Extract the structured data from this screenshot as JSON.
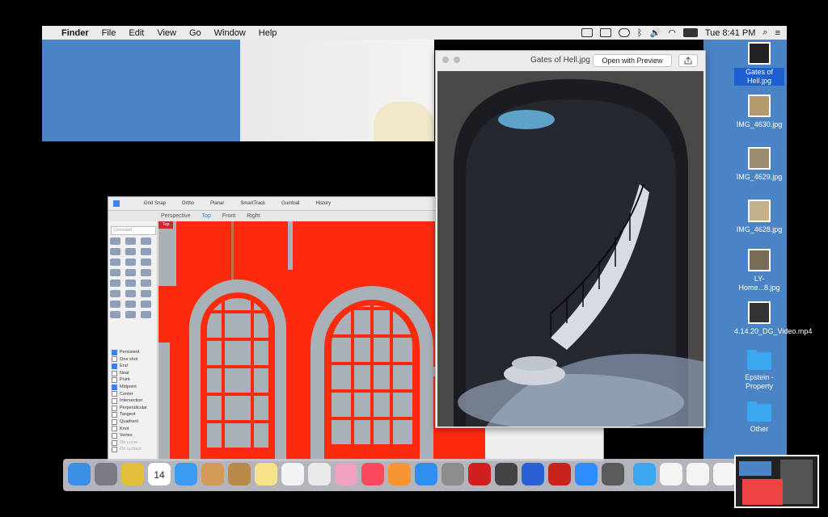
{
  "menubar": {
    "apple": "",
    "items": [
      "Finder",
      "File",
      "Edit",
      "View",
      "Go",
      "Window",
      "Help"
    ],
    "status": {
      "wifi": "wifi-icon",
      "volume": "volume-icon",
      "battery": "battery-icon",
      "clock": "Tue 8:41 PM"
    }
  },
  "preview": {
    "title": "Gates of Hell.jpg",
    "open_button": "Open with Preview",
    "share_icon": "share-icon"
  },
  "rhino": {
    "toolbar": [
      "Grid Snap",
      "Ortho",
      "Planar",
      "SmartTrack",
      "Gumball",
      "History"
    ],
    "viewport_tabs": [
      "Perspective",
      "Top",
      "Front",
      "Right"
    ],
    "active_tab": "Top",
    "command_placeholder": "Command",
    "viewport_label": "Top",
    "osnaps": [
      {
        "label": "Persistent",
        "checked": true
      },
      {
        "label": "One shot",
        "checked": false
      },
      {
        "label": "End",
        "checked": true
      },
      {
        "label": "Near",
        "checked": false
      },
      {
        "label": "Point",
        "checked": false
      },
      {
        "label": "Midpoint",
        "checked": true
      },
      {
        "label": "Center",
        "checked": false
      },
      {
        "label": "Intersection",
        "checked": false
      },
      {
        "label": "Perpendicular",
        "checked": false
      },
      {
        "label": "Tangent",
        "checked": false
      },
      {
        "label": "Quadrant",
        "checked": false
      },
      {
        "label": "Knot",
        "checked": false
      },
      {
        "label": "Vertex",
        "checked": false
      },
      {
        "label": "On curve",
        "checked": false
      },
      {
        "label": "On surface",
        "checked": false
      }
    ]
  },
  "desktop_icons": [
    {
      "label": "Gates of Hell.jpg",
      "selected": true
    },
    {
      "label": "IMG_4630.jpg",
      "selected": false
    },
    {
      "label": "IMG_4629.jpg",
      "selected": false
    },
    {
      "label": "IMG_4628.jpg",
      "selected": false
    },
    {
      "label": "LY-Home...8.jpg",
      "selected": false
    },
    {
      "label": "4.14.20_DG_Video.mp4",
      "selected": false
    },
    {
      "label": "Epstein - Property",
      "selected": false
    },
    {
      "label": "Other",
      "selected": false
    }
  ],
  "dock": {
    "calendar_day": "14",
    "apps": [
      "finder-icon",
      "launchpad-icon",
      "chrome-icon",
      "calendar-icon",
      "safari-icon",
      "preview-icon",
      "contacts-icon",
      "notes-icon",
      "reminders-icon",
      "textedit-icon",
      "photos-icon",
      "music-icon",
      "books-icon",
      "appstore-icon",
      "settings-icon",
      "autocad-icon",
      "rhino-icon",
      "word-icon",
      "acrobat-icon",
      "zoom-icon",
      "quicktime-icon"
    ]
  }
}
